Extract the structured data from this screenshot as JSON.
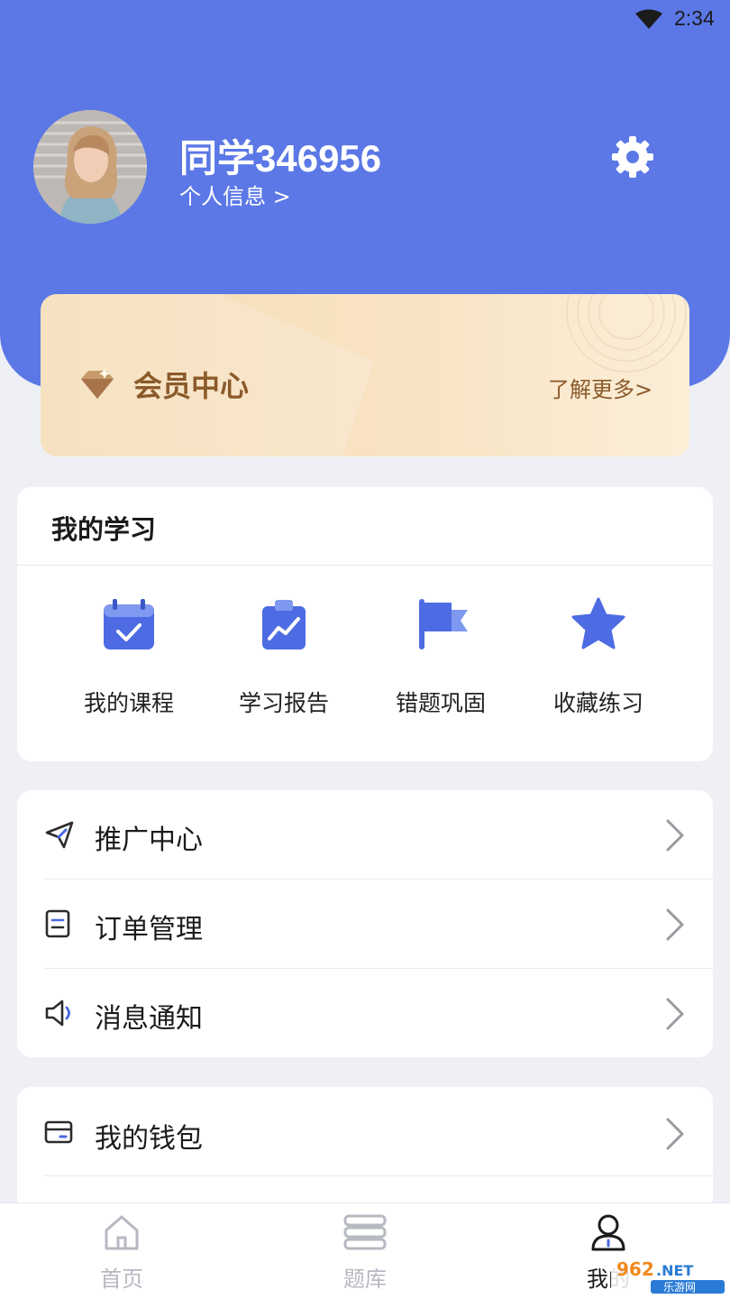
{
  "status_bar": {
    "time": "2:34"
  },
  "profile": {
    "username": "同学346956",
    "info_link": "个人信息 >"
  },
  "vip": {
    "title": "会员中心",
    "more": "了解更多>"
  },
  "study": {
    "title": "我的学习",
    "items": [
      {
        "label": "我的课程",
        "icon": "calendar-check-icon"
      },
      {
        "label": "学习报告",
        "icon": "clipboard-chart-icon"
      },
      {
        "label": "错题巩固",
        "icon": "flag-icon"
      },
      {
        "label": "收藏练习",
        "icon": "star-icon"
      }
    ]
  },
  "menu1": [
    {
      "label": "推广中心",
      "icon": "paper-plane-icon"
    },
    {
      "label": "订单管理",
      "icon": "document-icon"
    },
    {
      "label": "消息通知",
      "icon": "speaker-icon"
    }
  ],
  "menu2": [
    {
      "label": "我的钱包",
      "icon": "wallet-icon"
    }
  ],
  "tabbar": [
    {
      "label": "首页",
      "icon": "home-icon",
      "active": false
    },
    {
      "label": "题库",
      "icon": "question-bank-icon",
      "active": false
    },
    {
      "label": "我的",
      "icon": "user-icon",
      "active": true
    }
  ],
  "watermark": {
    "brand": "962.NET",
    "subtitle": "乐游网"
  },
  "colors": {
    "header": "#5b78e6",
    "accent": "#4a68e0",
    "vip_text": "#8b5a2b",
    "page_bg": "#eef0f5"
  }
}
